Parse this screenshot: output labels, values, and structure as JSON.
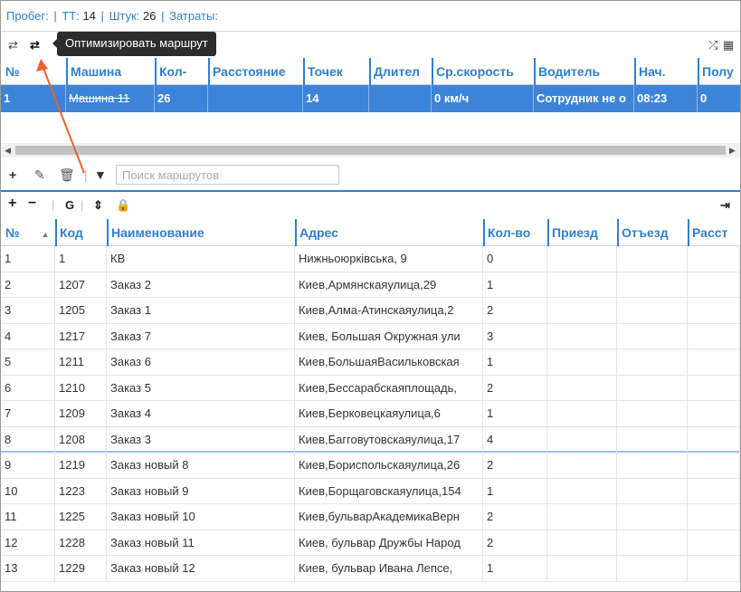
{
  "summary": {
    "mileage_label": "Пробег:",
    "tt_label": "ТТ:",
    "tt_value": "14",
    "pieces_label": "Штук:",
    "pieces_value": "26",
    "costs_label": "Затраты:"
  },
  "tooltip": "Оптимизировать маршрут",
  "route_table": {
    "headers": [
      "№",
      "Машина",
      "Кол-",
      "Расстояние",
      "Точек",
      "Длител",
      "Ср.скорость",
      "Водитель",
      "Нач.",
      "Полу"
    ],
    "rows": [
      [
        "1",
        "Машина 11",
        "26",
        "",
        "14",
        "",
        "0 км/ч",
        "Сотрудник не о",
        "08:23",
        "0"
      ]
    ]
  },
  "search": {
    "placeholder": "Поиск маршрутов"
  },
  "toolbar3": {
    "g_label": "G"
  },
  "orders_table": {
    "headers": [
      "№",
      "Код",
      "Наименование",
      "Адрес",
      "Кол-во",
      "Приезд",
      "Отъезд",
      "Расст"
    ],
    "rows": [
      [
        "1",
        "1",
        "КВ",
        "Нижньоюрківська, 9",
        "0"
      ],
      [
        "2",
        "1207",
        "Заказ 2",
        "Киев,Армянскаяулица,29",
        "1"
      ],
      [
        "3",
        "1205",
        "Заказ 1",
        "Киев,Алма-Атинскаяулица,2",
        "2"
      ],
      [
        "4",
        "1217",
        "Заказ 7",
        "Киев, Большая Окружная ули",
        "3"
      ],
      [
        "5",
        "1211",
        "Заказ 6",
        "Киев,БольшаяВасильковская",
        "1"
      ],
      [
        "6",
        "1210",
        "Заказ 5",
        "Киев,Бессарабскаяплощадь,",
        "2"
      ],
      [
        "7",
        "1209",
        "Заказ 4",
        "Киев,Берковецкаяулица,6",
        "1"
      ],
      [
        "8",
        "1208",
        "Заказ 3",
        "Киев,Багговутовскаяулица,17",
        "4"
      ],
      [
        "9",
        "1219",
        "Заказ новый 8",
        "Киев,Бориспольскаяулица,26",
        "2"
      ],
      [
        "10",
        "1223",
        "Заказ новый 9",
        "Киев,Борщаговскаяулица,154",
        "1"
      ],
      [
        "11",
        "1225",
        "Заказ новый 10",
        "Киев,бульварАкадемикаВерн",
        "2"
      ],
      [
        "12",
        "1228",
        "Заказ новый 11",
        "Киев, бульвар Дружбы Народ",
        "2"
      ],
      [
        "13",
        "1229",
        "Заказ новый 12",
        "Киев, бульвар Ивана Лепсе,",
        "1"
      ]
    ]
  },
  "icons": {
    "toolbar1_left": [
      "swap-icon",
      "optimize-route-icon"
    ],
    "toolbar1_right": [
      "shuffle-icon",
      "grid-icon"
    ],
    "toolbar2": [
      "plus-icon",
      "pencil-icon",
      "trash-icon",
      "filter-icon"
    ],
    "toolbar3": [
      "plus-icon",
      "minus-icon",
      "sort-icon",
      "lock-icon",
      "collapse-right-icon"
    ]
  },
  "colors": {
    "accent": "#2f7fd0",
    "selected_row": "#3d84d8",
    "tooltip_bg": "#2d2d2d",
    "annotation_arrow": "#e8622c"
  }
}
